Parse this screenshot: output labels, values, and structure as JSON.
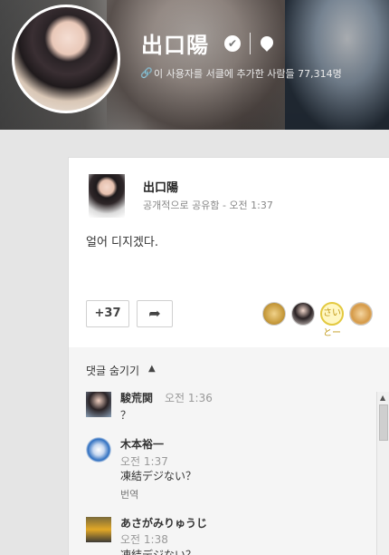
{
  "profile": {
    "name": "出口陽",
    "circle_count_text": "이 사용자를 서클에 추가한 사람들 77,314명"
  },
  "post": {
    "author": "出口陽",
    "meta": "공개적으로 공유함  -  오전 1:37",
    "text": "얼어 디지겠다.",
    "plus_count": "+37",
    "plussers": [
      "plusser-1",
      "plusser-2",
      "plusser-3",
      "plusser-4"
    ],
    "plusser_badge": "さいとー"
  },
  "comments": {
    "toggle_label": "댓글 숨기기",
    "items": [
      {
        "author": "駿荒関",
        "time": "오전 1:36",
        "text": "？"
      },
      {
        "author": "木本裕一",
        "time": "오전 1:37",
        "text": "凍結デジない？",
        "translate": "번역"
      },
      {
        "author": "あさがみりゅうじ",
        "time": "오전 1:38",
        "text": "凍結デジない？"
      }
    ]
  },
  "icons": {
    "verified": "verified-check-icon",
    "location": "location-pin-icon",
    "link": "link-icon",
    "share": "share-arrow-icon",
    "chevron": "chevron-up-icon"
  }
}
